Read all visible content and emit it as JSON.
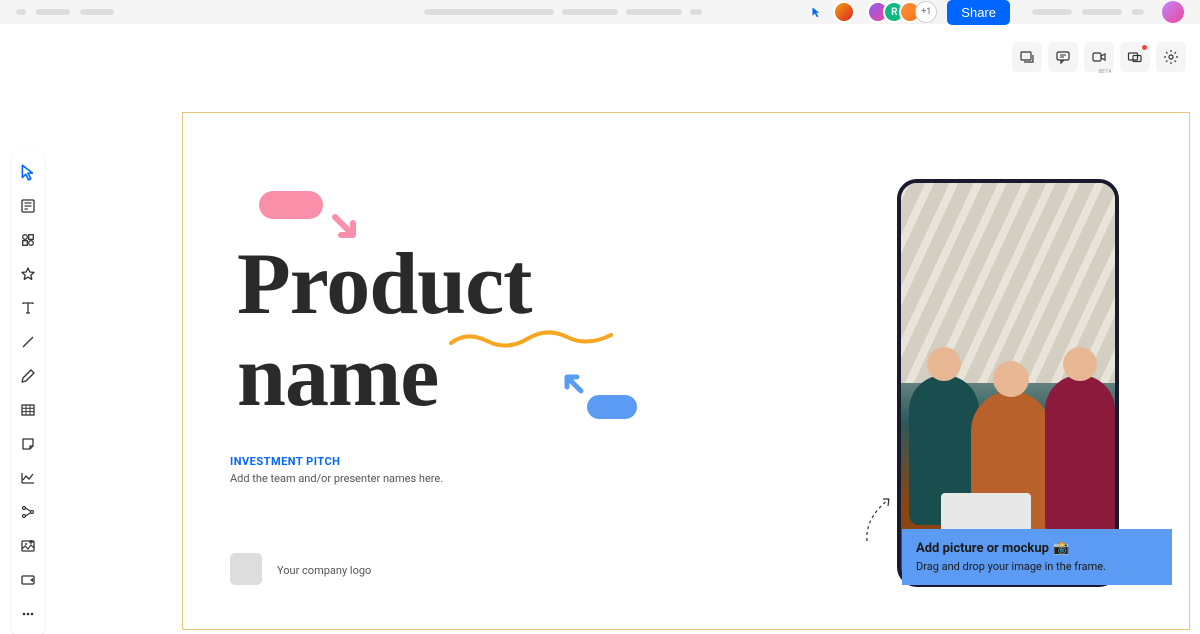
{
  "header": {
    "share_label": "Share",
    "avatar_letter": "R",
    "avatar_count": "+1",
    "beta_label": "BETA"
  },
  "slide": {
    "title_line1": "Product",
    "title_line2": "name",
    "subtitle": "INVESTMENT PITCH",
    "subline": "Add the team and/or presenter names here.",
    "logo_text": "Your company logo"
  },
  "callout": {
    "title": "Add picture or mockup",
    "emoji": "📸",
    "subtitle": "Drag and drop your image in the frame."
  }
}
